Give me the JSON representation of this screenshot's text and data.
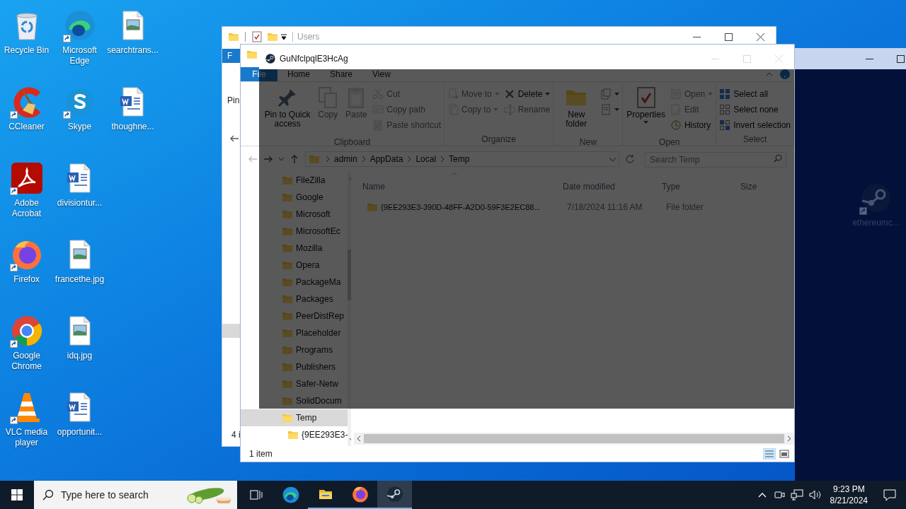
{
  "desktop_icons": [
    {
      "label": "Recycle Bin",
      "kind": "recycle",
      "shortcut": false
    },
    {
      "label": "CCleaner",
      "kind": "ccleaner",
      "shortcut": true
    },
    {
      "label": "Adobe Acrobat",
      "kind": "acrobat",
      "shortcut": true
    },
    {
      "label": "Firefox",
      "kind": "firefox",
      "shortcut": true
    },
    {
      "label": "Google Chrome",
      "kind": "chrome",
      "shortcut": true
    },
    {
      "label": "VLC media player",
      "kind": "vlc",
      "shortcut": true
    },
    {
      "label": "Microsoft Edge",
      "kind": "edge",
      "shortcut": true
    },
    {
      "label": "Skype",
      "kind": "skype",
      "shortcut": true
    },
    {
      "label": "divisiontur...",
      "kind": "word",
      "shortcut": false
    },
    {
      "label": "francethe.jpg",
      "kind": "image",
      "shortcut": false
    },
    {
      "label": "idq.jpg",
      "kind": "image",
      "shortcut": false
    },
    {
      "label": "opportunit...",
      "kind": "word",
      "shortcut": false
    },
    {
      "label": "searchtrans...",
      "kind": "image",
      "shortcut": false
    },
    {
      "label": "thoughne...",
      "kind": "word",
      "shortcut": false
    }
  ],
  "hidden_desktop_icon": {
    "label": "ethereumc...",
    "kind": "steam",
    "shortcut": true
  },
  "back_window": {
    "title": "Users",
    "file_tab": "F",
    "ribbon_label": "Pin",
    "status": "4 i"
  },
  "explorer": {
    "ribbon_tabs": [
      {
        "label": "File",
        "kind": "file",
        "selected": false
      },
      {
        "label": "Home",
        "kind": "tab",
        "selected": false
      },
      {
        "label": "Share",
        "kind": "tab",
        "selected": false
      },
      {
        "label": "View",
        "kind": "tab",
        "selected": false
      }
    ],
    "ribbon_groups": [
      {
        "label": "Clipboard",
        "columns": [
          [
            {
              "label": "Pin to Quick access",
              "kind": "pin",
              "large": true,
              "disabled": false,
              "dropdown": false
            }
          ],
          [
            {
              "label": "Copy",
              "kind": "copy",
              "large": true,
              "disabled": true,
              "dropdown": false
            }
          ],
          [
            {
              "label": "Paste",
              "kind": "paste",
              "large": true,
              "disabled": true,
              "dropdown": false
            }
          ],
          [
            {
              "label": "Cut",
              "kind": "cut",
              "large": false,
              "disabled": true,
              "dropdown": false
            },
            {
              "label": "Copy path",
              "kind": "copy_path",
              "large": false,
              "disabled": true,
              "dropdown": false
            },
            {
              "label": "Paste shortcut",
              "kind": "paste_shortcut",
              "large": false,
              "disabled": true,
              "dropdown": false
            }
          ]
        ]
      },
      {
        "label": "Organize",
        "columns": [
          [
            {
              "label": "Move to",
              "kind": "move_to",
              "large": false,
              "disabled": true,
              "dropdown": true
            },
            {
              "label": "Copy to",
              "kind": "copy_to",
              "large": false,
              "disabled": true,
              "dropdown": true
            }
          ],
          [
            {
              "label": "Delete",
              "kind": "delete",
              "large": false,
              "disabled": false,
              "dropdown": true
            },
            {
              "label": "Rename",
              "kind": "rename",
              "large": false,
              "disabled": true,
              "dropdown": false
            }
          ]
        ]
      },
      {
        "label": "New",
        "columns": [
          [
            {
              "label": "New folder",
              "kind": "new_folder",
              "large": true,
              "disabled": false,
              "dropdown": false
            }
          ],
          [
            {
              "kind": "new_item",
              "large": false,
              "disabled": false,
              "dropdown": true
            },
            {
              "kind": "easy_access",
              "large": false,
              "disabled": false,
              "dropdown": true
            }
          ]
        ]
      },
      {
        "label": "Open",
        "columns": [
          [
            {
              "label": "Properties",
              "kind": "properties",
              "large": true,
              "disabled": false,
              "dropdown": true
            }
          ],
          [
            {
              "label": "Open",
              "kind": "open",
              "large": false,
              "disabled": true,
              "dropdown": true
            },
            {
              "label": "Edit",
              "kind": "edit",
              "large": false,
              "disabled": true,
              "dropdown": false
            },
            {
              "label": "History",
              "kind": "history",
              "large": false,
              "disabled": false,
              "dropdown": false
            }
          ]
        ]
      },
      {
        "label": "Select",
        "columns": [
          [
            {
              "label": "Select all",
              "kind": "select_all",
              "large": false,
              "disabled": false,
              "dropdown": false
            },
            {
              "label": "Select none",
              "kind": "select_none",
              "large": false,
              "disabled": false,
              "dropdown": false
            },
            {
              "label": "Invert selection",
              "kind": "invert",
              "large": false,
              "disabled": false,
              "dropdown": false
            }
          ]
        ]
      }
    ],
    "breadcrumbs": [
      "admin",
      "AppData",
      "Local",
      "Temp"
    ],
    "search": {
      "placeholder": "Search Temp"
    },
    "nav_items": [
      {
        "label": "FileZilla",
        "selected": false
      },
      {
        "label": "Google",
        "selected": false
      },
      {
        "label": "Microsoft",
        "selected": false
      },
      {
        "label": "MicrosoftEc",
        "selected": false
      },
      {
        "label": "Mozilla",
        "selected": false
      },
      {
        "label": "Opera",
        "selected": false
      },
      {
        "label": "PackageMa",
        "selected": false
      },
      {
        "label": "Packages",
        "selected": false
      },
      {
        "label": "PeerDistRep",
        "selected": false
      },
      {
        "label": "Placeholder",
        "selected": false
      },
      {
        "label": "Programs",
        "selected": false
      },
      {
        "label": "Publishers",
        "selected": false
      },
      {
        "label": "Safer-Netw",
        "selected": false
      },
      {
        "label": "SolidDocum",
        "selected": false
      },
      {
        "label": "Temp",
        "selected": true,
        "children": [
          {
            "label": "{9EE293E3-",
            "selected": false
          }
        ]
      }
    ],
    "columns": [
      "Name",
      "Date modified",
      "Type",
      "Size"
    ],
    "rows": [
      {
        "name": "{9EE293E3-390D-48FF-A2D0-59F3E2EC88...",
        "date": "7/18/2024 11:16 AM",
        "type": "File folder",
        "selected": false
      }
    ],
    "status": "1 item"
  },
  "overlay_window": {
    "title": "GuNfclpqlE3HcAg"
  },
  "taskbar": {
    "search_placeholder": "Type here to search",
    "apps": [
      {
        "kind": "task_view",
        "running": false,
        "selected": false
      },
      {
        "kind": "edge",
        "running": false,
        "selected": false
      },
      {
        "kind": "explorer",
        "running": true,
        "selected": false
      },
      {
        "kind": "firefox",
        "running": true,
        "selected": false
      },
      {
        "kind": "steam",
        "running": true,
        "selected": true
      }
    ],
    "time": "9:23 PM",
    "date": "8/21/2024"
  }
}
